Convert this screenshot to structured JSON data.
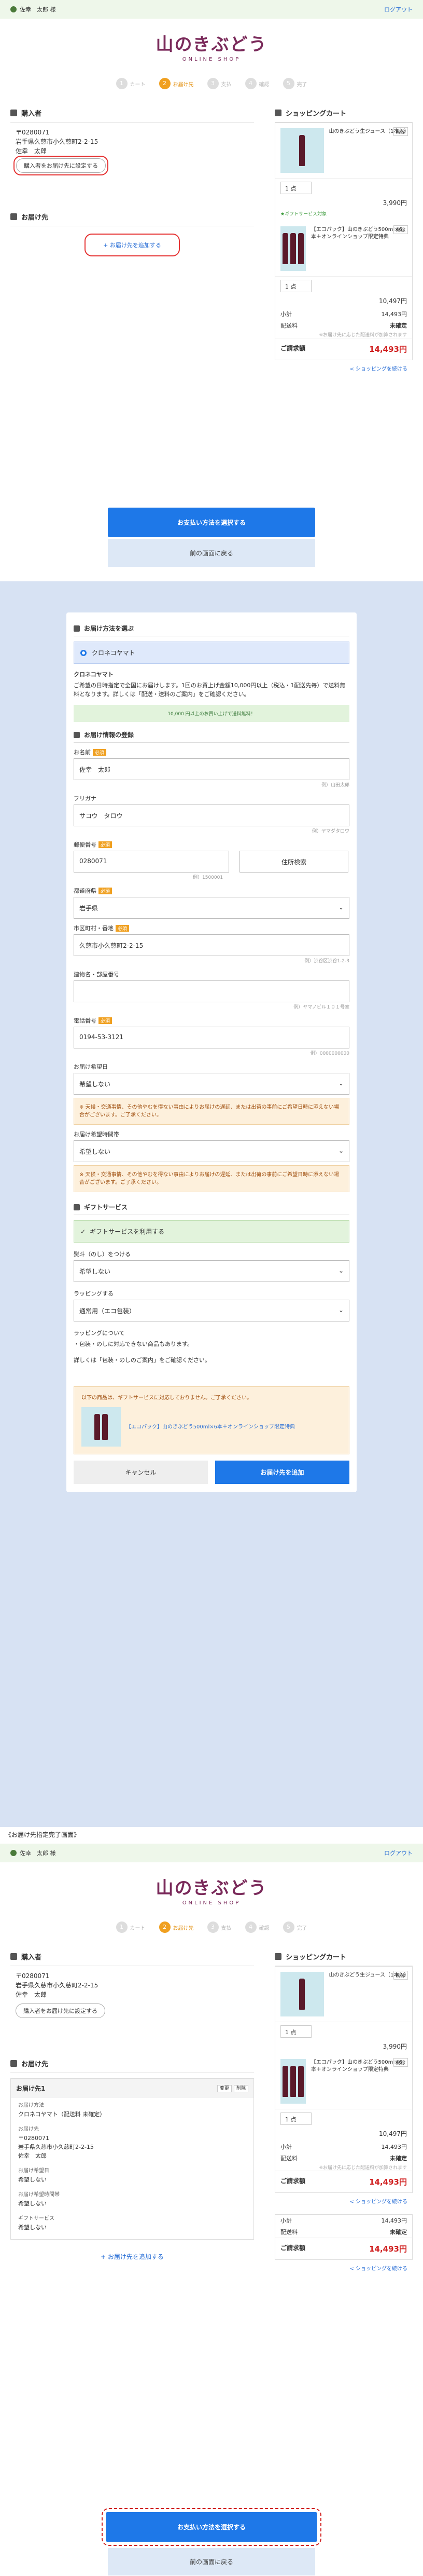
{
  "top": {
    "user": "佐幸　太郎 様",
    "logout": "ログアウト"
  },
  "logo": {
    "main": "山のきぶどう",
    "sub": "ONLINE SHOP"
  },
  "steps": [
    {
      "n": "1",
      "label": "カート"
    },
    {
      "n": "2",
      "label": "お届け先"
    },
    {
      "n": "3",
      "label": "支払"
    },
    {
      "n": "4",
      "label": "確認"
    },
    {
      "n": "5",
      "label": "完了"
    }
  ],
  "buyer": {
    "title": "購入者",
    "zip": "〒0280071",
    "addr": "岩手県久慈市小久慈町2-2-15",
    "name": "佐幸　太郎",
    "btn": "購入者をお届け先に設定する"
  },
  "ship": {
    "title": "お届け先",
    "add": "+ お届け先を追加する"
  },
  "cart": {
    "title": "ショッピングカート",
    "delete": "削除",
    "items": [
      {
        "name": "山のきぶどう生ジュース（1本入）",
        "qty": "1 点",
        "price": "3,990円"
      },
      {
        "name": "【エコパック】山のきぶどう500ml×6本＋オンラインショップ限定特典",
        "qty": "1 点",
        "price": "10,497円"
      }
    ],
    "giftnote": "★ギフトサービス対象",
    "subtotal_k": "小計",
    "subtotal_v": "14,493円",
    "fee_k": "配送料",
    "fee_v": "未確定",
    "note": "※お届け先に応じた配送料が加算されます",
    "total_k": "ご請求額",
    "total_v": "14,493円",
    "continue": "< ショッピングを続ける"
  },
  "actions": {
    "pay": "お支払い方法を選択する",
    "back": "前の画面に戻る"
  },
  "modal": {
    "method_title": "お届け方法を選ぶ",
    "carrier": "クロネコヤマト",
    "carrier_sub": "クロネコヤマト",
    "desc": "ご希望の日時指定で全国にお届けします。1回のお買上げ金額10,000円以上（税込・1配送先毎）で送料無料となります。詳しくは「配送・送料のご案内」をご確認ください。",
    "free_banner": "10,000 円以上のお買い上げで送料無料！",
    "info_title": "お届け情報の登録",
    "name_l": "お名前",
    "name_v": "佐幸　太郎",
    "name_h": "例）山田太郎",
    "kana_l": "フリガナ",
    "kana_v": "サコウ　タロウ",
    "kana_h": "例）ヤマダタロウ",
    "zip_l": "郵便番号",
    "zip_v": "0280071",
    "zip_btn": "住所検索",
    "zip_h": "例）1500001",
    "pref_l": "都道府県",
    "pref_v": "岩手県",
    "city_l": "市区町村・番地",
    "city_v": "久慈市小久慈町2-2-15",
    "city_h": "例）渋谷区渋谷1-2-3",
    "bldg_l": "建物名・部屋番号",
    "bldg_h": "例）ヤマノビル１０１号室",
    "tel_l": "電話番号",
    "tel_v": "0194-53-3121",
    "tel_h": "例）0000000000",
    "date_l": "お届け希望日",
    "date_v": "希望しない",
    "date_warn": "※ 天候・交通事情、その他やむを得ない事由によりお届けの遅延、または出荷の事前にご希望日時に添えない場合がございます。ご了承ください。",
    "time_l": "お届け希望時間帯",
    "time_v": "希望しない",
    "time_warn": "※ 天候・交通事情、その他やむを得ない事由によりお届けの遅延、または出荷の事前にご希望日時に添えない場合がございます。ご了承ください。",
    "gift_title": "ギフトサービス",
    "gift_use": "ギフトサービスを利用する",
    "noshi_l": "熨斗（のし）をつける",
    "noshi_v": "希望しない",
    "wrap_l": "ラッピングする",
    "wrap_v": "通常用（エコ包装）",
    "wrap_note1": "ラッピングについて",
    "wrap_note2": "・包装・のしに対応できない商品もあります。",
    "wrap_note3": "詳しくは「包装・のしのご案内」をご確認ください。",
    "nogift": "以下の商品は、ギフトサービスに対応しておりません。ご了承ください。",
    "nogift_item": "【エコパック】山のきぶどう500ml×6本＋オンラインショップ限定特典",
    "cancel": "キャンセル",
    "submit": "お届け先を追加"
  },
  "caption": "《お届け先指定完了画面》",
  "done": {
    "card_title": "お届け先1",
    "edit": "変更",
    "del": "削除",
    "method_k": "お届け方法",
    "method_v": "クロネコヤマト（配送料 未確定）",
    "dest_k": "お届け先",
    "dest_zip": "〒0280071",
    "dest_addr": "岩手県久慈市小久慈町2-2-15",
    "dest_name": "佐幸　太郎",
    "date_k": "お届け希望日",
    "date_v": "希望しない",
    "time_k": "お届け希望時間帯",
    "time_v": "希望しない",
    "gift_k": "ギフトサービス",
    "gift_v": "希望しない"
  }
}
